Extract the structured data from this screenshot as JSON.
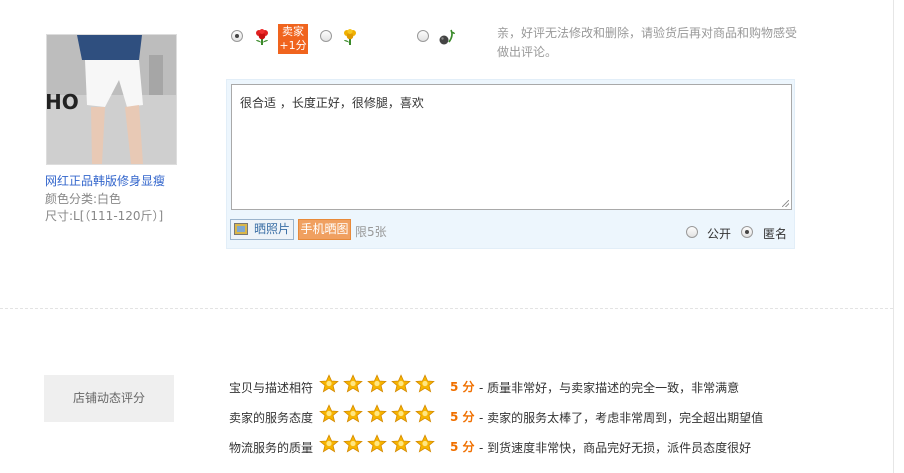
{
  "product": {
    "title": "网红正品韩版修身显瘦",
    "color": "颜色分类:白色",
    "size": "尺寸:L[（111-120斤）]",
    "thumb_text": "HO"
  },
  "rating": {
    "options": [
      {
        "icon": "good-rating-flower-icon",
        "checked": true
      },
      {
        "icon": "neutral-rating-flower-icon",
        "checked": false
      },
      {
        "icon": "bad-rating-icon",
        "checked": false
      }
    ],
    "seller_badge": [
      "卖家",
      "+1分"
    ],
    "tip": "亲，好评无法修改和删除，请验货后再对商品和购物感受做出评论。"
  },
  "comment": {
    "text": "很合适 ，长度正好，很修腿，喜欢",
    "photo_button": "晒照片",
    "mobile_button": "手机晒图",
    "limit": "限5张",
    "visibility": {
      "public": "公开",
      "anonymous": "匿名",
      "selected": "anonymous"
    }
  },
  "shop_score": {
    "button": "店铺动态评分",
    "rows": [
      {
        "label": "宝贝与描述相符",
        "stars": 5,
        "score": "5 分",
        "desc": "- 质量非常好，与卖家描述的完全一致，非常满意"
      },
      {
        "label": "卖家的服务态度",
        "stars": 5,
        "score": "5 分",
        "desc": "- 卖家的服务太棒了，考虑非常周到，完全超出期望值"
      },
      {
        "label": "物流服务的质量",
        "stars": 5,
        "score": "5 分",
        "desc": "- 到货速度非常快，商品完好无损，派件员态度很好"
      }
    ]
  },
  "colors": {
    "accent": "#f07000",
    "link": "#3366cc",
    "star": "#f7b500"
  }
}
